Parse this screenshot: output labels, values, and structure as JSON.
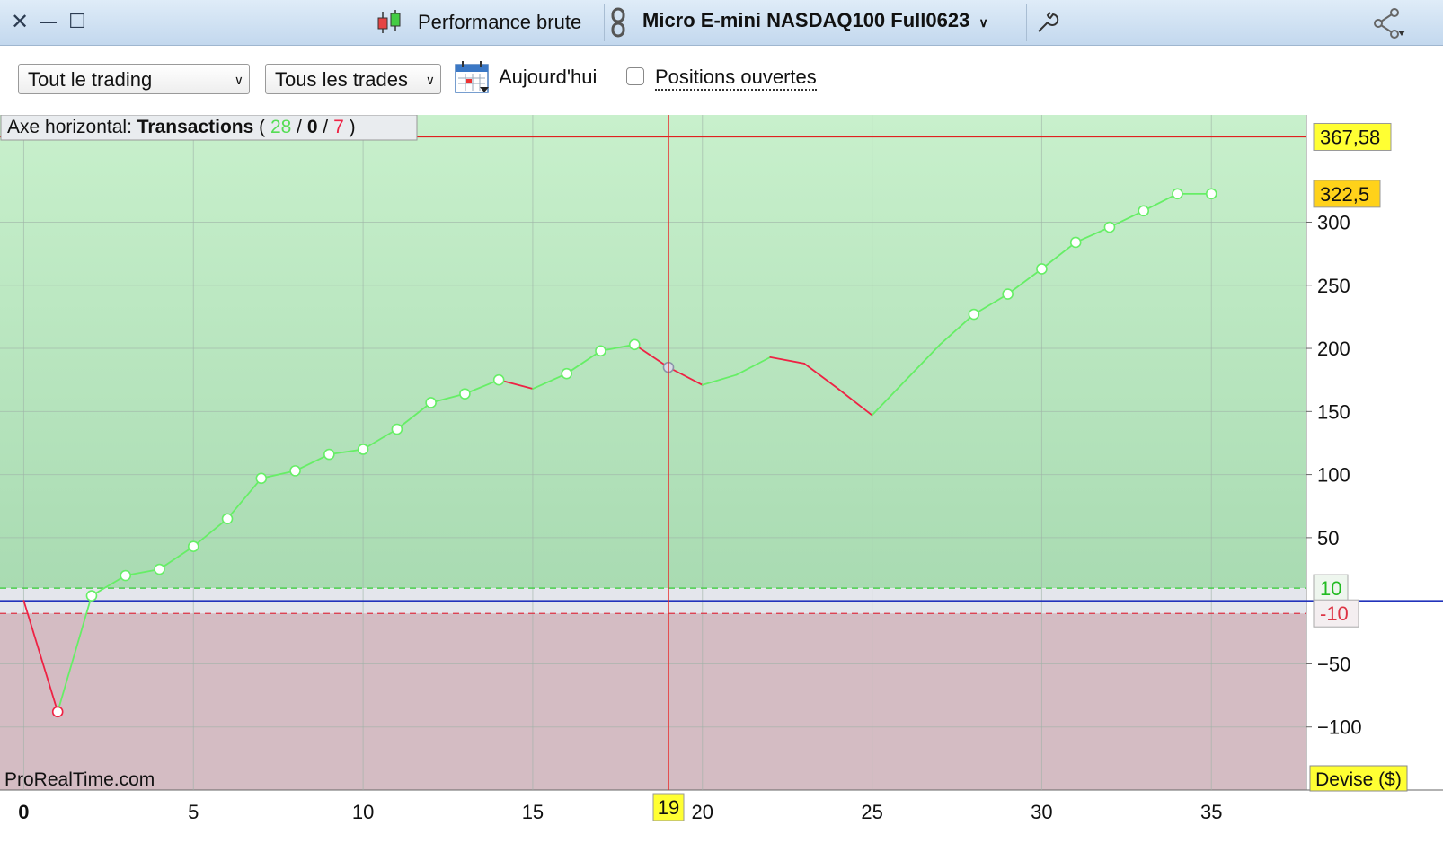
{
  "window": {
    "close_label": "✕",
    "minimize_label": "—",
    "maximize_label": "☐",
    "title": "Performance brute",
    "instrument": "Micro E-mini NASDAQ100 Full0623"
  },
  "toolbar": {
    "scope_select": "Tout le trading",
    "trades_select": "Tous les trades",
    "date_label": "Aujourd'hui",
    "open_positions_label": "Positions ouvertes",
    "open_positions_checked": false
  },
  "chart_data": {
    "type": "line",
    "header_prefix": "Axe horizontal: ",
    "header_axis": "Transactions",
    "counts": {
      "winning": "28",
      "neutral": "0",
      "losing": "7"
    },
    "x": [
      0,
      1,
      2,
      3,
      4,
      5,
      6,
      7,
      8,
      9,
      10,
      11,
      12,
      13,
      14,
      15,
      16,
      17,
      18,
      19,
      20,
      21,
      22,
      23,
      24,
      25,
      26,
      27,
      28,
      29,
      30,
      31,
      32,
      33,
      34,
      35
    ],
    "y": [
      0,
      -88,
      4,
      20,
      25,
      43,
      65,
      97,
      103,
      116,
      120,
      136,
      157,
      164,
      175,
      168,
      180,
      198,
      203,
      185,
      171,
      179,
      193,
      188,
      168,
      147,
      175,
      203,
      227,
      243,
      263,
      284,
      296,
      309,
      322.5,
      322.5
    ],
    "markers": [
      1,
      2,
      3,
      4,
      5,
      6,
      7,
      8,
      9,
      10,
      11,
      12,
      13,
      14,
      16,
      17,
      18,
      19,
      28,
      29,
      30,
      31,
      32,
      33,
      34,
      35
    ],
    "cursor_x": 19,
    "cursor_label": "19",
    "max_label": "367,58",
    "max_value": 367.58,
    "last_label": "322,5",
    "last_value": 322.5,
    "threshold_up_label": "10",
    "threshold_up": 10,
    "threshold_down_label": "-10",
    "threshold_down": -10,
    "x_ticks": [
      "0",
      "5",
      "10",
      "15",
      "20",
      "25",
      "30",
      "35"
    ],
    "x_tick_values": [
      0,
      5,
      10,
      15,
      20,
      25,
      30,
      35
    ],
    "y_ticks": [
      "300",
      "250",
      "200",
      "150",
      "100",
      "50",
      "−50",
      "−100"
    ],
    "y_tick_values": [
      300,
      250,
      200,
      150,
      100,
      50,
      -50,
      -100
    ],
    "xlim": [
      -0.7,
      37.8
    ],
    "ylim": [
      -150,
      385
    ],
    "currency_label": "Devise ($)",
    "watermark": "ProRealTime.com",
    "colors": {
      "gain_line": "#66ee66",
      "loss_line": "#ee2244",
      "gain_bg": "#bfe7c6",
      "loss_bg": "#d4bcc3",
      "cursor": "#e82a2a",
      "baseline": "#2233bb",
      "label_bg": "#ffff33"
    }
  }
}
